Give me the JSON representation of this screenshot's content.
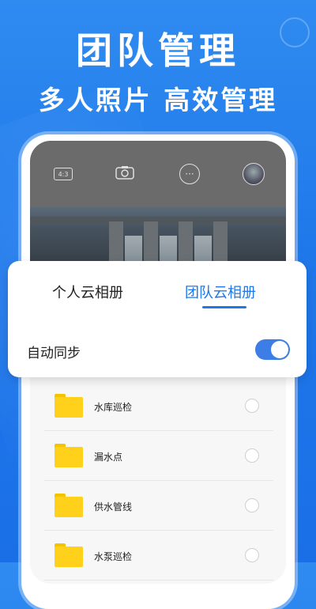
{
  "promo": {
    "headline": "团队管理",
    "subheadline": "多人照片  高效管理"
  },
  "camera_bar": {
    "ratio_label": "4:3",
    "icons": [
      "aspect-ratio-icon",
      "camera-flip-icon",
      "more-icon",
      "avatar"
    ]
  },
  "album_tabs": {
    "personal": "个人云相册",
    "team": "团队云相册",
    "active": "团队云相册"
  },
  "sync": {
    "label": "自动同步",
    "enabled": true
  },
  "folders": [
    {
      "name": "水库巡检"
    },
    {
      "name": "漏水点"
    },
    {
      "name": "供水管线"
    },
    {
      "name": "水泵巡检"
    }
  ],
  "colors": {
    "accent": "#1f78ea",
    "toggle_on": "#3c7ee6",
    "folder": "#ffd11a"
  }
}
